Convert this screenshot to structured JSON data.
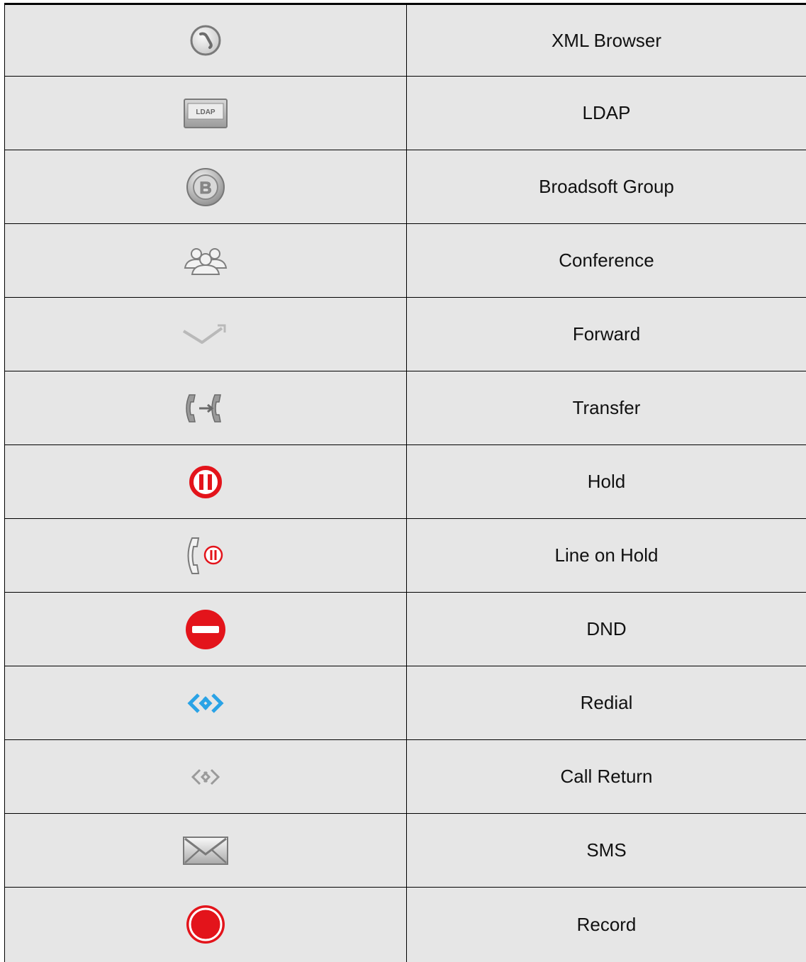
{
  "rows": [
    {
      "icon": "xml-browser-icon",
      "label": "XML Browser"
    },
    {
      "icon": "ldap-icon",
      "label": "LDAP",
      "icon_text": "LDAP"
    },
    {
      "icon": "broadsoft-group-icon",
      "label": "Broadsoft Group",
      "icon_text": "B"
    },
    {
      "icon": "conference-icon",
      "label": "Conference"
    },
    {
      "icon": "forward-icon",
      "label": "Forward"
    },
    {
      "icon": "transfer-icon",
      "label": "Transfer"
    },
    {
      "icon": "hold-icon",
      "label": "Hold"
    },
    {
      "icon": "line-on-hold-icon",
      "label": "Line on Hold"
    },
    {
      "icon": "dnd-icon",
      "label": "DND"
    },
    {
      "icon": "redial-icon",
      "label": "Redial"
    },
    {
      "icon": "call-return-icon",
      "label": "Call Return"
    },
    {
      "icon": "sms-icon",
      "label": "SMS"
    },
    {
      "icon": "record-icon",
      "label": "Record"
    }
  ],
  "colors": {
    "cell_background": "#e6e6e6",
    "icon_grey": "#8a8a8a",
    "alert_red": "#e3141b",
    "redial_blue": "#2aa3e6"
  }
}
